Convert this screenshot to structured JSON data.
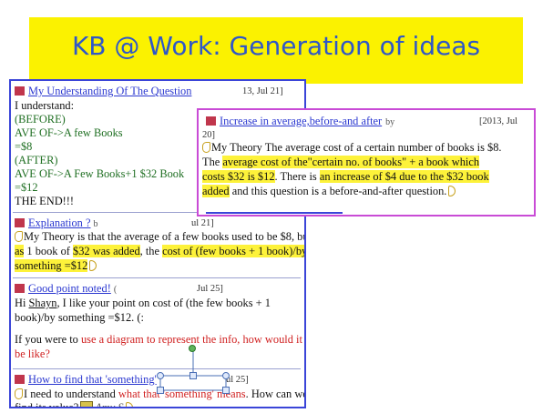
{
  "slide": {
    "title": "KB @ Work: Generation of ideas"
  },
  "notes": [
    {
      "title": "My Understanding Of The Question",
      "date": "13, Jul 21]",
      "lines": [
        "I understand:",
        "(BEFORE)",
        "AVE OF->A few Books",
        "=$8",
        "(AFTER)",
        "AVE OF->A Few Books+1 $32 Book",
        "=$12",
        "THE END!!!"
      ]
    },
    {
      "title": "Explanation ?",
      "date": "ul 21]",
      "author_frag": "b",
      "p1": "My Theory is that the average of a few books used to be $8, but",
      "p2a": "as",
      "p2b": " 1 book of ",
      "p2c": "$32 was added",
      "p2d": ", the ",
      "p2e": "cost of (few books + 1 book)/by",
      "p3": "something =$12"
    },
    {
      "title": "Good point noted!",
      "author_frag": "(",
      "date": "Jul 25]",
      "l1a": "Hi ",
      "l1b": "Shayn",
      "l1c": ", I like your point on cost of (the few books + 1",
      "l2": "book)/by something =$12. (:",
      "l3a": "If you were to ",
      "l3b": "use a diagram to represent the info, how would it",
      "l4": "be like?"
    },
    {
      "title": "How to find that 'something'",
      "date": "ul 25]",
      "l1a": "I need to understand ",
      "l1b": "what that 'something' means",
      "l1c": ". How can we",
      "l2a": "find its value?",
      "l2b": "Amy S"
    }
  ],
  "popup": {
    "title": "Increase in average,before-and after",
    "author_frag": "by",
    "date": "[2013, Jul",
    "date2": "20]",
    "l1": "My Theory The average cost of a certain number of books is $8.",
    "l2a": "The ",
    "l2b": "average cost of the\"certain no. of books\" + a book which",
    "l3a": "costs $32 is $12",
    "l3b": ". There is ",
    "l3c": "an increase of $4 due to the $32 book",
    "l4a": "added",
    "l4b": " and this question is a before-and-after question."
  },
  "colors": {
    "title_band": "#fbf200",
    "title_text": "#2f57c8",
    "panel_border": "#3b45d8",
    "popup_border": "#c94bd6",
    "highlight": "#fdf23a"
  }
}
